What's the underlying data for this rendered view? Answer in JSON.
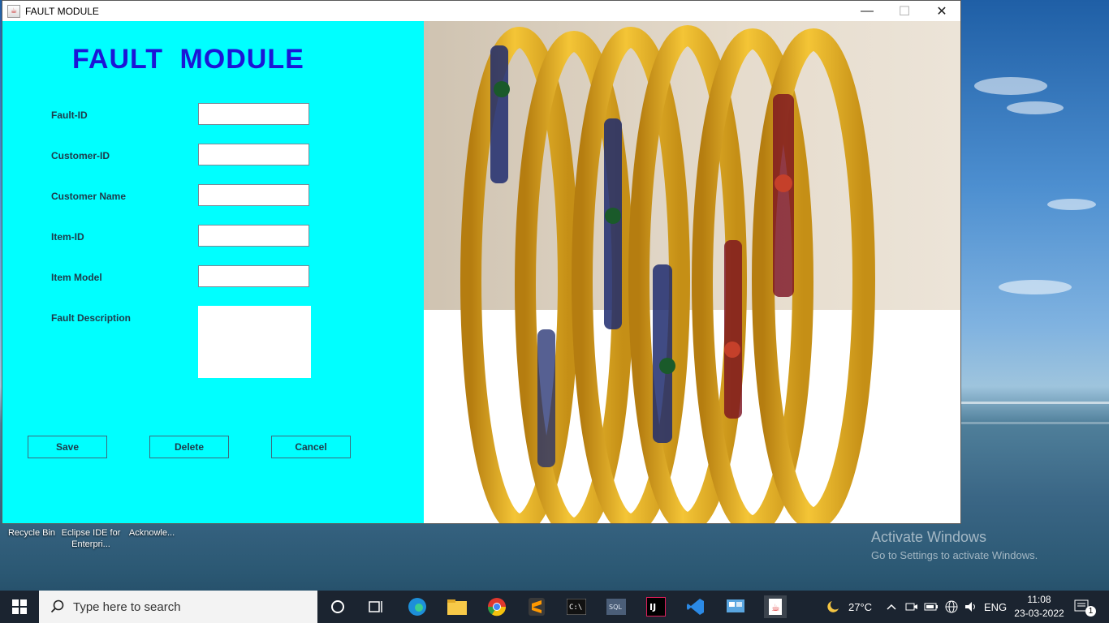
{
  "window": {
    "title": "FAULT MODULE",
    "minimize_glyph": "—",
    "maximize_glyph": "☐",
    "close_glyph": "✕"
  },
  "form": {
    "heading": "FAULT  MODULE",
    "fields": [
      {
        "label": "Fault-ID",
        "value": ""
      },
      {
        "label": "Customer-ID",
        "value": ""
      },
      {
        "label": "Customer Name",
        "value": ""
      },
      {
        "label": "Item-ID",
        "value": ""
      },
      {
        "label": "Item Model",
        "value": ""
      }
    ],
    "description_label": "Fault Description",
    "description_value": "",
    "buttons": {
      "save": "Save",
      "delete": "Delete",
      "cancel": "Cancel"
    }
  },
  "desktop": {
    "icons": [
      {
        "label": "Recycle Bin",
        "icon": "recycle-bin-icon"
      },
      {
        "label": "Eclipse IDE for Enterpri...",
        "icon": "eclipse-icon"
      },
      {
        "label": "Acknowle...",
        "icon": "file-icon"
      }
    ],
    "watermark_line1": "Activate Windows",
    "watermark_line2": "Go to Settings to activate Windows."
  },
  "taskbar": {
    "search_placeholder": "Type here to search",
    "weather": "27°C",
    "language": "ENG",
    "time": "11:08",
    "date": "23-03-2022",
    "notification_count": "1"
  },
  "colors": {
    "form_bg": "#00ffff",
    "heading": "#1c16d6",
    "taskbar": "#1b2430"
  }
}
